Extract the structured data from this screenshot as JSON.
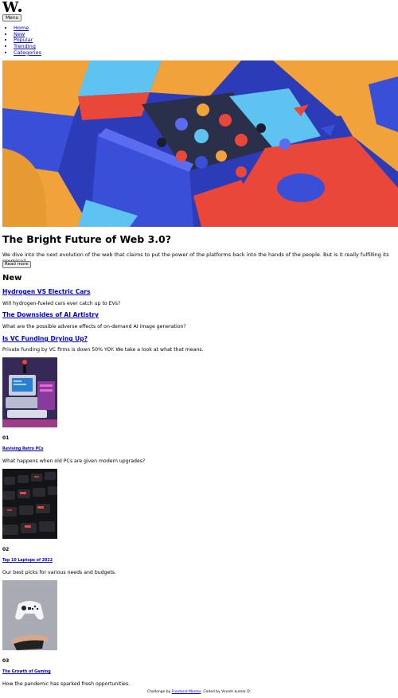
{
  "header": {
    "logo_text": "W",
    "menu_label": "Menu"
  },
  "nav": {
    "items": [
      "Home",
      "New",
      "Popular",
      "Trending",
      "Categories"
    ]
  },
  "hero": {
    "title": "The Bright Future of Web 3.0?",
    "description": "We dive into the next evolution of the web that claims to put the power of the platforms back into the hands of the people. But is it really fulfilling its promise?",
    "button_label": "Read more"
  },
  "new_section": {
    "title": "New",
    "items": [
      {
        "title": "Hydrogen VS Electric Cars",
        "description": "Will hydrogen-fueled cars ever catch up to EVs?"
      },
      {
        "title": "The Downsides of AI Artistry",
        "description": "What are the possible adverse effects of on-demand AI image generation?"
      },
      {
        "title": "Is VC Funding Drying Up?",
        "description": "Private funding by VC firms is down 50% YOY. We take a look at what that means."
      }
    ]
  },
  "top_articles": [
    {
      "number": "01",
      "title": "Reviving Retro PCs",
      "description": "What happens when old PCs are given modern upgrades?"
    },
    {
      "number": "02",
      "title": "Top 10 Laptops of 2022",
      "description": "Our best picks for various needs and budgets."
    },
    {
      "number": "03",
      "title": "The Growth of Gaming",
      "description": "How the pandemic has sparked fresh opportunities."
    }
  ],
  "footer": {
    "prefix": "Challenge by ",
    "link": "Frontend Mentor",
    "suffix": ". Coded by Vinesh kumar D."
  },
  "colors": {
    "link": "#0000ee",
    "hero_blue": "#3a4fd8",
    "hero_orange": "#f2a23a",
    "hero_red": "#e8473a"
  }
}
